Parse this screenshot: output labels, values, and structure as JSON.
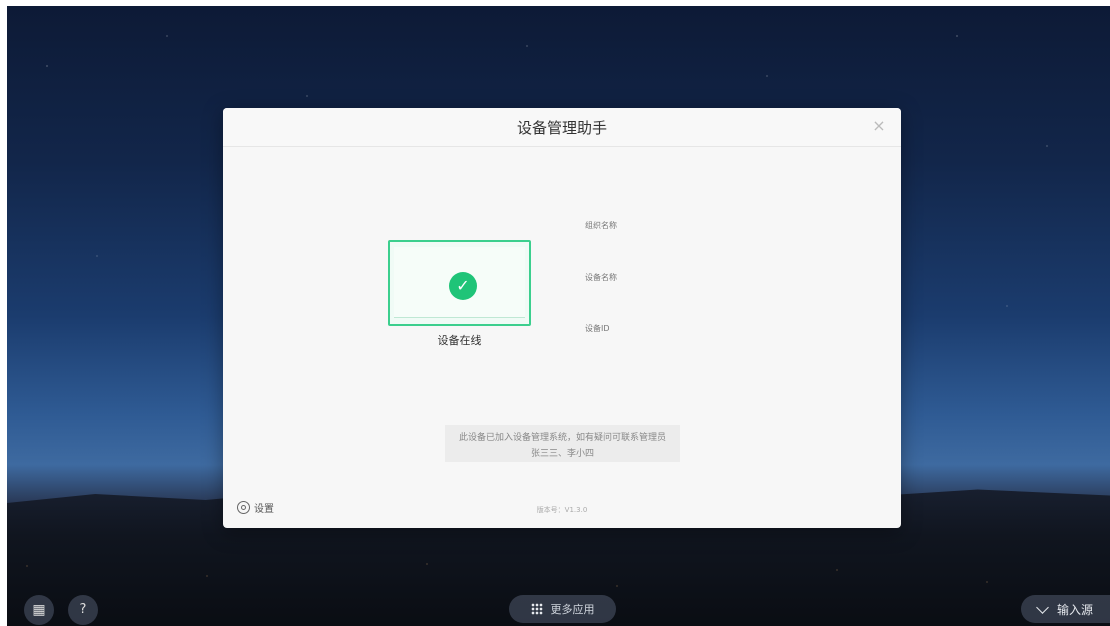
{
  "dialog": {
    "title": "设备管理助手",
    "close_glyph": "×",
    "status": "设备在线",
    "labels": {
      "org_name": "组织名称",
      "device_name": "设备名称",
      "device_id": "设备ID"
    },
    "notice": {
      "line1": "此设备已加入设备管理系统，如有疑问可联系管理员",
      "line2": "张三三、李小四"
    },
    "settings_label": "设置",
    "version": "版本号：V1.3.0"
  },
  "taskbar": {
    "more_apps_label": "更多应用",
    "input_source_label": "输入源",
    "help_glyph": "?",
    "windows_glyph": "▦"
  },
  "colors": {
    "accent_green": "#1fc478",
    "box_border": "#3ccf8e"
  }
}
